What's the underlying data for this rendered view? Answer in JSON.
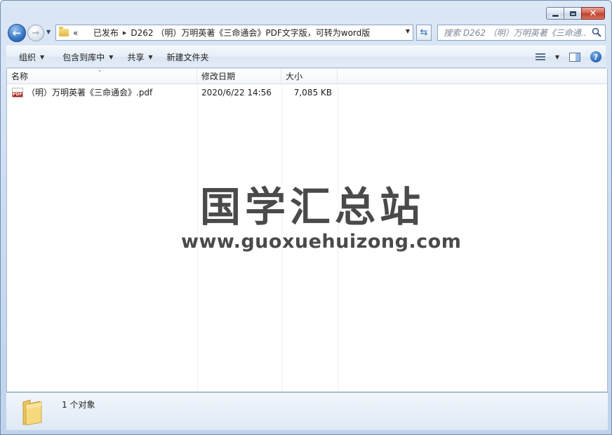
{
  "window": {
    "caption": {
      "minimize": "–",
      "maximize": "□",
      "close": "✕"
    }
  },
  "nav": {
    "back_icon": "arrow-left-icon",
    "forward_icon": "arrow-right-icon",
    "address": {
      "overflow": "«",
      "crumbs": [
        "已发布",
        "D262 （明）万明英著《三命通会》PDF文字版，可转为word版"
      ],
      "separator": "▸"
    },
    "search": {
      "placeholder": "搜索 D262 （明）万明英著《三命通..."
    }
  },
  "toolbar": {
    "organize": "组织",
    "include_in_library": "包含到库中",
    "share": "共享",
    "new_folder": "新建文件夹"
  },
  "columns": {
    "name": "名称",
    "date": "修改日期",
    "size": "大小"
  },
  "files": [
    {
      "name": "（明）万明英著《三命通会》.pdf",
      "date": "2020/6/22 14:56",
      "size": "7,085 KB",
      "icon": "pdf-file-icon"
    }
  ],
  "watermark": {
    "title": "国学汇总站",
    "url": "www.guoxuehuizong.com"
  },
  "details": {
    "count": "1 个对象"
  }
}
